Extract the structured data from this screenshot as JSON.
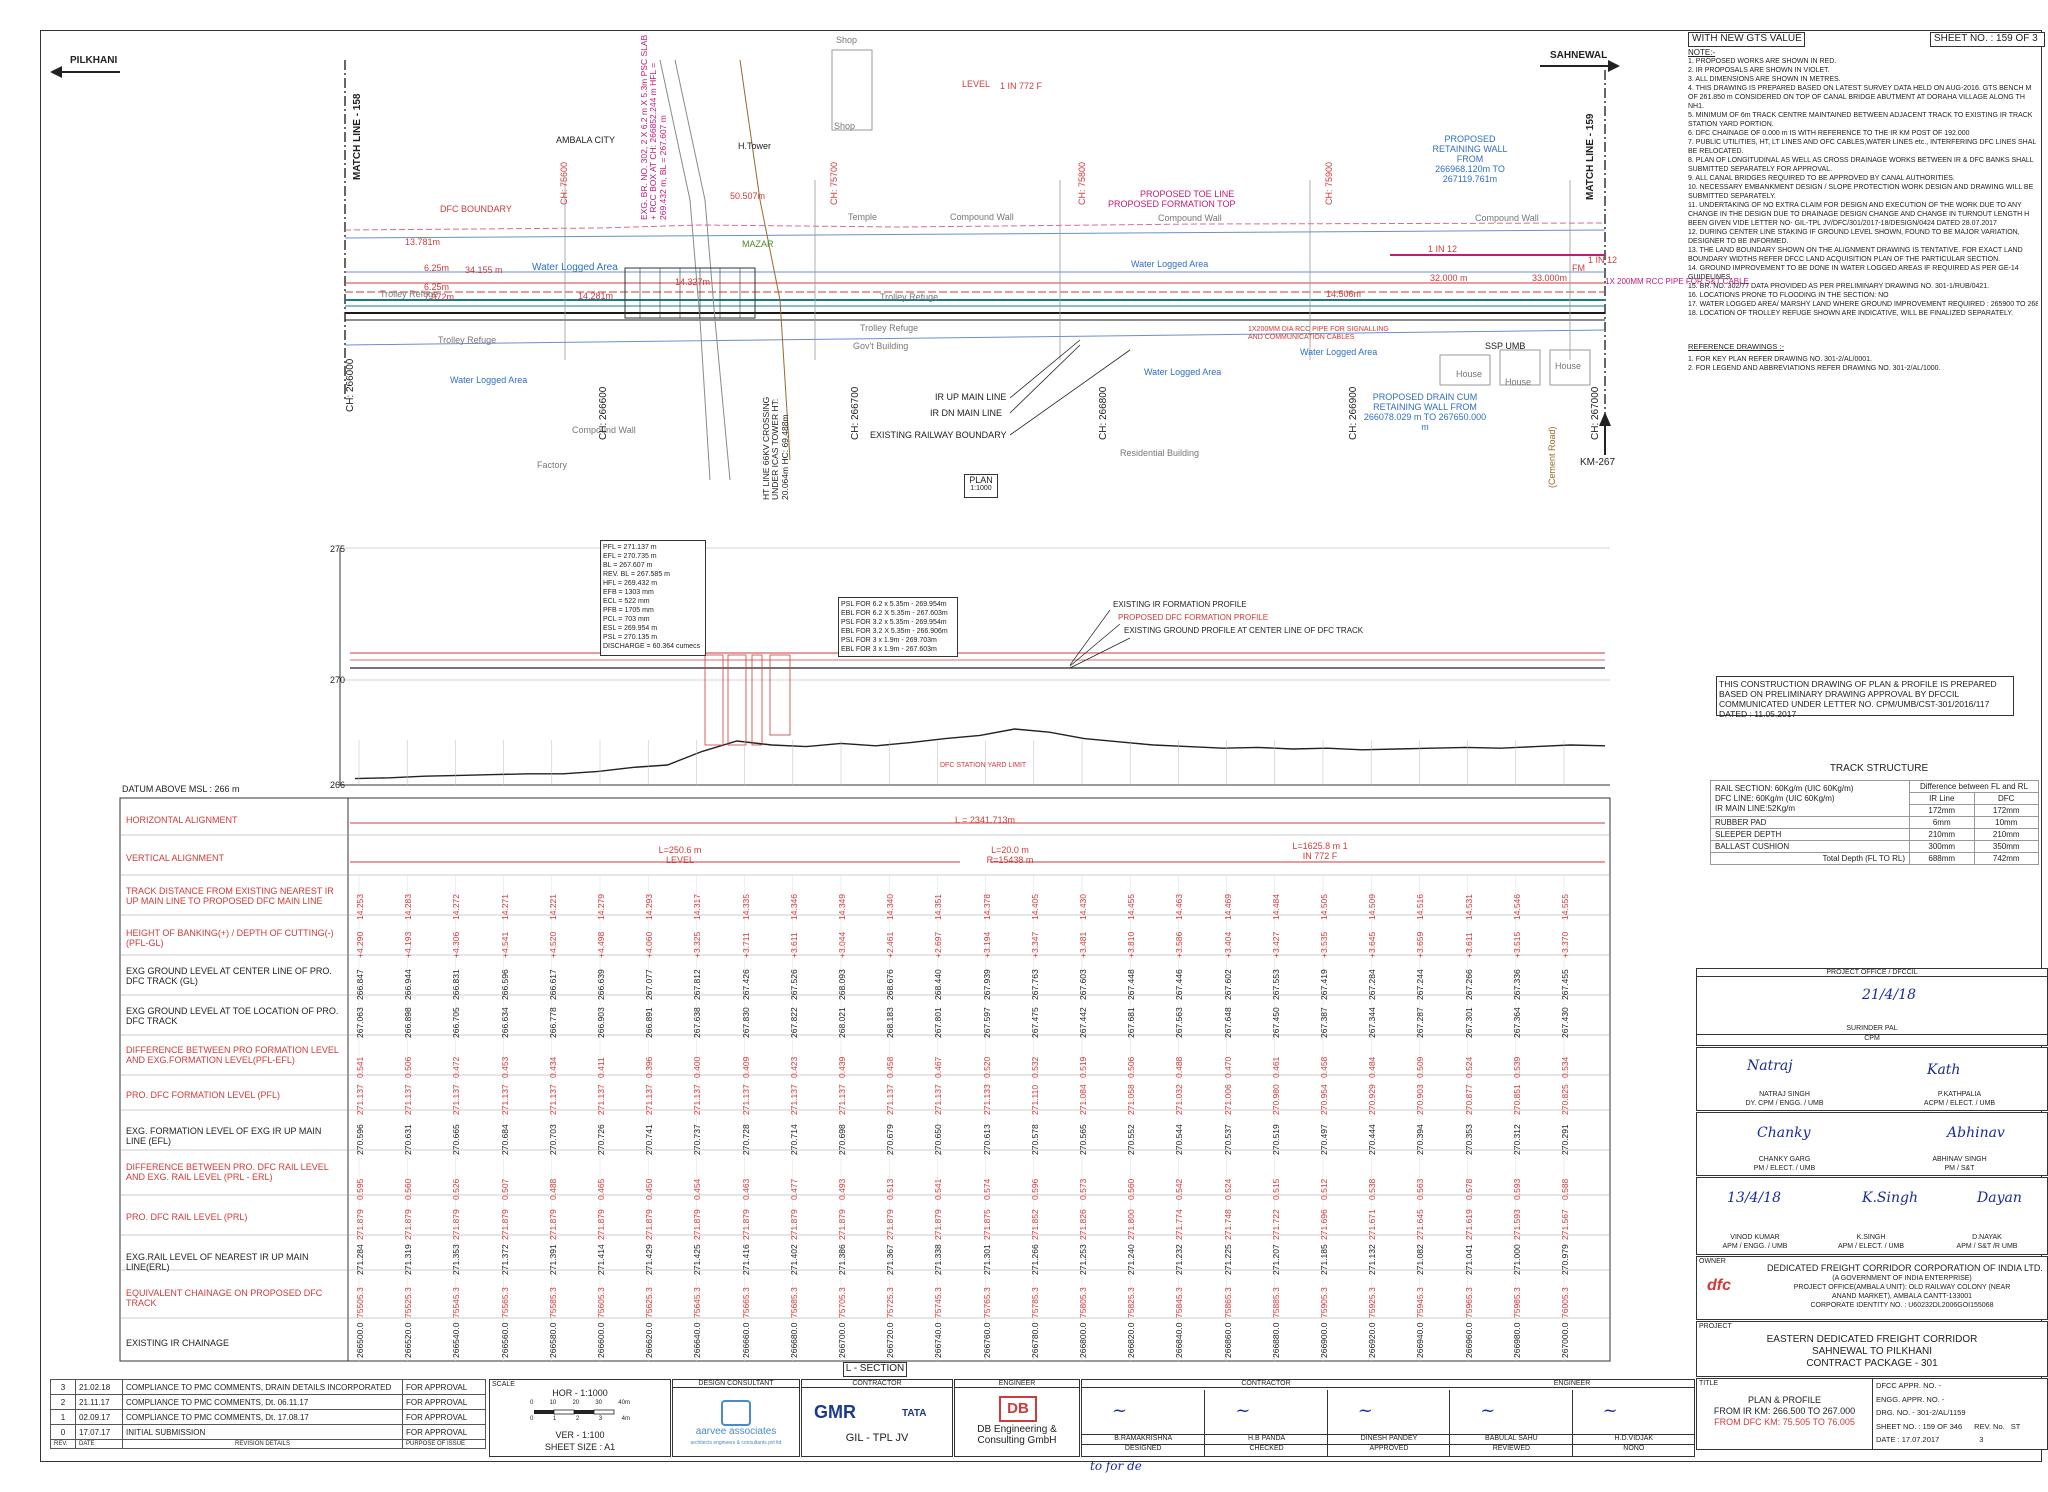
{
  "sheet": {
    "header": "WITH NEW GTS VALUE",
    "sheet_no": "SHEET NO. : 159 OF 3"
  },
  "plan": {
    "left_dir": "PILKHANI",
    "right_dir": "SAHNEWAL",
    "match_left": "MATCH LINE - 158",
    "match_right": "MATCH LINE - 159",
    "plan_label": "PLAN",
    "plan_scale": "1:1000",
    "km_marker": "KM-267",
    "labels": {
      "ambala_city": "AMBALA CITY",
      "dfc_boundary": "DFC BOUNDARY",
      "water_logged": "Water Logged Area",
      "trolley_refuge": "Trolley Refuge",
      "compound_wall": "Compound Wall",
      "factory": "Factory",
      "residential": "Residential Building",
      "shop": "Shop",
      "temple": "Temple",
      "govt_building": "Gov't Building",
      "house": "House",
      "h_tower": "H.Tower",
      "mazar": "MAZAR",
      "level": "LEVEL",
      "in772": "1 IN 772 F",
      "in12": "1 IN 12",
      "fm": "FM",
      "ir_up": "IR UP MAIN LINE",
      "ir_dn": "IR DN MAIN LINE",
      "exist_boundary": "EXISTING RAILWAY BOUNDARY",
      "prop_toe": "PROPOSED TOE LINE",
      "prop_formation_top": "PROPOSED FORMATION TOP",
      "ret_wall": "PROPOSED RETAINING WALL FROM 266968.120m TO 267119.761m",
      "drain_cum": "PROPOSED DRAIN CUM RETAINING WALL FROM 266078.029 m TO 267650.000 m",
      "pipe": "1X200MM DIA RCC PIPE FOR SIGNALLING AND COMMUNICATION CABLES",
      "ssp": "SSP UMB",
      "cement_road": "(Cement Road)",
      "dim1": "13.781m",
      "dim2": "6.25m",
      "dim3": "34.155 m",
      "dim4": "6.25m",
      "dim5": "7.972m",
      "dim6": "14.281m",
      "dim7": "14.327m",
      "dim8": "50.507m",
      "dim9": "14.506m",
      "dim10": "32.000 m",
      "dim11": "33.000m",
      "hand_note": "1X 200MM RCC PIPE FOR S&T CABLE"
    },
    "chainages": [
      "CH: 266000",
      "CH: 266600",
      "CH: 266700",
      "CH: 266800",
      "CH: 266900",
      "CH: 267000",
      "CH: 75600",
      "CH: 75700",
      "CH: 75800",
      "CH: 75900"
    ],
    "bridge_text": "EXG. BR. NO. 302, 2 X 6.2 m X 5.3m PSC SLAB + RCC BOX AT CH: 266852.244 m HFL = 269.432 m, BL = 267.607 m",
    "ht_line": "HT LINE 66KV CROSSING UNDER ICAS TOWER HT: 20.064m HC: 69.488m"
  },
  "profile": {
    "datum": "DATUM ABOVE MSL : 266 m",
    "y_ticks": [
      "275",
      "270",
      "266"
    ],
    "legend": [
      "EXISTING IR FORMATION PROFILE",
      "PROPOSED DFC FORMATION PROFILE",
      "EXISTING GROUND PROFILE AT CENTER LINE OF DFC TRACK"
    ],
    "station_label": "DFC STATION YARD LIMIT",
    "bridge_box": [
      "PFL = 271.137 m",
      "EFL = 270.735 m",
      "BL = 267.607 m",
      "REV. BL = 267.585 m",
      "HFL = 269.432 m",
      "EFB = 1303 mm",
      "ECL = 522 mm",
      "PFB = 1705 mm",
      "PCL = 703 mm",
      "ESL = 269.954 m",
      "PSL = 270.135 m",
      "DISCHARGE = 60.364 cumecs"
    ],
    "psl_box": [
      "PSL FOR 6.2 x 5.35m - 269.954m",
      "EBL FOR 6.2 X 5.35m - 267.603m",
      "PSL FOR 3.2 x 5.35m - 269.954m",
      "EBL FOR 3.2 X 5.35m - 266.906m",
      "PSL FOR 3 x 1.9m - 269.703m",
      "EBL FOR 3 x 1.9m - 267.603m"
    ],
    "ground_profile": [
      0.08,
      0.09,
      0.11,
      0.12,
      0.13,
      0.14,
      0.14,
      0.17,
      0.22,
      0.25,
      0.42,
      0.55,
      0.5,
      0.48,
      0.52,
      0.49,
      0.53,
      0.58,
      0.62,
      0.7,
      0.66,
      0.58,
      0.54,
      0.5,
      0.48,
      0.46,
      0.47,
      0.45,
      0.46,
      0.44,
      0.45,
      0.46,
      0.47,
      0.46,
      0.48,
      0.5,
      0.49
    ]
  },
  "lsection": {
    "title": "L - SECTION",
    "rows": {
      "h_align": "HORIZONTAL ALIGNMENT",
      "v_align": "VERTICAL ALIGNMENT",
      "track_dist": "TRACK DISTANCE FROM EXISTING NEAREST IR UP MAIN LINE TO PROPOSED DFC MAIN LINE",
      "bank": "HEIGHT OF BANKING(+) / DEPTH OF CUTTING(-) (PFL-GL)",
      "gl_center": "EXG GROUND LEVEL AT CENTER LINE OF PRO. DFC TRACK (GL)",
      "gl_toe": "EXG GROUND LEVEL AT TOE LOCATION OF PRO. DFC TRACK",
      "diff_pfl": "DIFFERENCE BETWEEN PRO FORMATION LEVEL AND EXG.FORMATION LEVEL(PFL-EFL)",
      "pfl": "PRO. DFC FORMATION LEVEL (PFL)",
      "efl": "EXG. FORMATION LEVEL OF EXG IR UP MAIN LINE (EFL)",
      "diff_prl": "DIFFERENCE BETWEEN PRO. DFC RAIL LEVEL AND EXG. RAIL LEVEL (PRL - ERL)",
      "prl": "PRO. DFC RAIL LEVEL (PRL)",
      "erl": "EXG.RAIL LEVEL OF NEAREST IR UP MAIN LINE(ERL)",
      "eq_chain": "EQUIVALENT CHAINAGE ON PROPOSED DFC TRACK",
      "ir_chain": "EXISTING IR CHAINAGE"
    },
    "h_align_val": "L = 2341.713m",
    "v_align_vals": [
      "L=250.6 m LEVEL",
      "L=20.0 m R=15438 m",
      "L=1625.8 m 1 IN 772 F"
    ],
    "track_dist": [
      "14.253",
      "14.283",
      "14.272",
      "14.271",
      "14.221",
      "14.279",
      "14.293",
      "14.317",
      "14.335",
      "14.346",
      "14.349",
      "14.340",
      "14.351",
      "14.378",
      "14.405",
      "14.430",
      "14.455",
      "14.463",
      "14.469",
      "14.484",
      "14.505",
      "14.509",
      "14.516",
      "14.531",
      "14.546",
      "14.555"
    ],
    "bank": [
      "+4.290",
      "+4.193",
      "+4.306",
      "+4.541",
      "+4.520",
      "+4.498",
      "+4.060",
      "+3.325",
      "+3.711",
      "+3.611",
      "+3.044",
      "+2.461",
      "+2.697",
      "+3.194",
      "+3.347",
      "+3.481",
      "+3.810",
      "+3.586",
      "+3.404",
      "+3.427",
      "+3.535",
      "+3.645",
      "+3.659",
      "+3.611",
      "+3.515",
      "+3.370"
    ],
    "gl_center": [
      "266.847",
      "266.944",
      "266.831",
      "266.596",
      "266.617",
      "266.639",
      "267.077",
      "267.812",
      "267.426",
      "267.526",
      "268.093",
      "268.676",
      "268.440",
      "267.939",
      "267.763",
      "267.603",
      "267.448",
      "267.446",
      "267.602",
      "267.553",
      "267.419",
      "267.284",
      "267.244",
      "267.266",
      "267.336",
      "267.455"
    ],
    "gl_toe": [
      "267.063",
      "266.898",
      "266.705",
      "266.634",
      "266.778",
      "266.903",
      "266.891",
      "267.638",
      "267.830",
      "267.822",
      "268.021",
      "268.183",
      "267.801",
      "267.597",
      "267.475",
      "267.442",
      "267.681",
      "267.563",
      "267.648",
      "267.450",
      "267.387",
      "267.344",
      "267.287",
      "267.301",
      "267.364",
      "267.430"
    ],
    "diff_pfl": [
      "0.541",
      "0.506",
      "0.472",
      "0.453",
      "0.434",
      "0.411",
      "0.396",
      "0.400",
      "0.409",
      "0.423",
      "0.439",
      "0.458",
      "0.467",
      "0.520",
      "0.532",
      "0.519",
      "0.506",
      "0.488",
      "0.470",
      "0.461",
      "0.458",
      "0.484",
      "0.509",
      "0.524",
      "0.539",
      "0.534"
    ],
    "pfl": [
      "271.137",
      "271.137",
      "271.137",
      "271.137",
      "271.137",
      "271.137",
      "271.137",
      "271.137",
      "271.137",
      "271.137",
      "271.137",
      "271.137",
      "271.137",
      "271.133",
      "271.110",
      "271.084",
      "271.058",
      "271.032",
      "271.006",
      "270.980",
      "270.954",
      "270.929",
      "270.903",
      "270.877",
      "270.851",
      "270.825"
    ],
    "efl": [
      "270.596",
      "270.631",
      "270.665",
      "270.684",
      "270.703",
      "270.726",
      "270.741",
      "270.737",
      "270.728",
      "270.714",
      "270.698",
      "270.679",
      "270.650",
      "270.613",
      "270.578",
      "270.565",
      "270.552",
      "270.544",
      "270.537",
      "270.519",
      "270.497",
      "270.444",
      "270.394",
      "270.353",
      "270.312",
      "270.291"
    ],
    "diff_prl": [
      "0.595",
      "0.560",
      "0.526",
      "0.507",
      "0.488",
      "0.465",
      "0.450",
      "0.454",
      "0.463",
      "0.477",
      "0.493",
      "0.513",
      "0.541",
      "0.574",
      "0.596",
      "0.573",
      "0.560",
      "0.542",
      "0.524",
      "0.515",
      "0.512",
      "0.538",
      "0.563",
      "0.578",
      "0.593",
      "0.588"
    ],
    "prl": [
      "271.879",
      "271.879",
      "271.879",
      "271.879",
      "271.879",
      "271.879",
      "271.879",
      "271.879",
      "271.879",
      "271.879",
      "271.879",
      "271.879",
      "271.879",
      "271.875",
      "271.852",
      "271.826",
      "271.800",
      "271.774",
      "271.748",
      "271.722",
      "271.696",
      "271.671",
      "271.645",
      "271.619",
      "271.593",
      "271.567"
    ],
    "erl": [
      "271.284",
      "271.319",
      "271.353",
      "271.372",
      "271.391",
      "271.414",
      "271.429",
      "271.425",
      "271.416",
      "271.402",
      "271.386",
      "271.367",
      "271.338",
      "271.301",
      "271.266",
      "271.253",
      "271.240",
      "271.232",
      "271.225",
      "271.207",
      "271.185",
      "271.132",
      "271.082",
      "271.041",
      "271.000",
      "270.979"
    ],
    "eq_chain": [
      "75505.3",
      "75525.3",
      "75545.3",
      "75565.3",
      "75585.3",
      "75605.3",
      "75625.3",
      "75645.3",
      "75665.3",
      "75685.3",
      "75705.3",
      "75725.3",
      "75745.3",
      "75765.3",
      "75785.3",
      "75805.3",
      "75825.3",
      "75845.3",
      "75865.3",
      "75885.3",
      "75905.3",
      "75925.3",
      "75945.3",
      "75965.3",
      "75985.3",
      "76005.3"
    ],
    "ir_chain": [
      "266500.0",
      "266520.0",
      "266540.0",
      "266560.0",
      "266580.0",
      "266600.0",
      "266620.0",
      "266640.0",
      "266660.0",
      "266680.0",
      "266700.0",
      "266720.0",
      "266740.0",
      "266760.0",
      "266780.0",
      "266800.0",
      "266820.0",
      "266840.0",
      "266860.0",
      "266880.0",
      "266900.0",
      "266920.0",
      "266940.0",
      "266960.0",
      "266980.0",
      "267000.0"
    ]
  },
  "notes": {
    "title": "NOTE:-",
    "items": [
      "1.  PROPOSED WORKS ARE SHOWN IN RED.",
      "2.  IR PROPOSALS ARE SHOWN IN VIOLET.",
      "3.  ALL DIMENSIONS ARE SHOWN IN METRES.",
      "4.  THIS DRAWING IS PREPARED BASED ON LATEST SURVEY DATA HELD ON AUG-2016. GTS BENCH M",
      "     OF 261.850 m CONSIDERED ON TOP OF CANAL BRIDGE ABUTMENT AT DORAHA VILLAGE ALONG TH",
      "     NH1.",
      "5.  MINIMUM OF 6m TRACK CENTRE MAINTAINED BETWEEN ADJACENT TRACK TO EXISTING IR TRACK",
      "     STATION YARD PORTION.",
      "6.  DFC CHAINAGE OF 0.000 m IS WITH REFERENCE TO THE IR KM POST OF 192.000",
      "7.  PUBLIC UTILITIES, HT, LT LINES AND OFC CABLES,WATER LINES etc., INTERFERING DFC LINES SHAL",
      "     BE RELOCATED.",
      "8.  PLAN OF LONGITUDINAL AS WELL AS CROSS DRAINAGE WORKS BETWEEN IR & DFC BANKS SHALL",
      "     SUBMITTED SEPARATELY FOR APPROVAL.",
      "9.  ALL CANAL BRIDGES REQUIRED TO BE APPROVED BY CANAL AUTHORITIES.",
      "10. NECESSARY EMBANKMENT DESIGN / SLOPE PROTECTION WORK DESIGN AND DRAWING WILL BE",
      "     SUBMITTED SEPARATELY.",
      "11. UNDERTAKING OF NO EXTRA CLAIM FOR DESIGN AND EXECUTION OF THE WORK DUE TO ANY",
      "     CHANGE IN THE DESIGN DUE TO DRAINAGE DESIGN CHANGE AND CHANGE IN TURNOUT LENGTH H",
      "     BEEN GIVEN VIDE LETTER NO- GIL-TPL JV/DFC/301/2017-18/DESIGN/0424 DATED 28.07.2017",
      "12. DURING CENTER LINE STAKING IF GROUND LEVEL SHOWN, FOUND TO BE MAJOR VARIATION,",
      "     DESIGNER TO BE INFORMED.",
      "13. THE LAND BOUNDARY SHOWN ON THE ALIGNMENT DRAWING IS TENTATIVE. FOR EXACT LAND",
      "     BOUNDARY WIDTHS REFER DFCC LAND ACQUISITION PLAN OF THE PARTICULAR SECTION.",
      "14. GROUND IMPROVEMENT TO BE DONE IN WATER LOGGED AREAS IF REQUIRED AS PER  GE-14",
      "     GUIDELINES.",
      "15. BR. NO. 302/77 DATA PROVIDED AS PER PRELIMINARY DRAWING NO. 301-1/RUB/0421.",
      "16. LOCATIONS PRONE TO FLOODING IN THE SECTION: NO",
      "17. WATER LOGGED AREA/ MARSHY LAND WHERE GROUND IMPROVEMENT REQUIRED : 265900 TO 2685",
      "18. LOCATION OF TROLLEY REFUGE SHOWN ARE INDICATIVE, WILL BE FINALIZED SEPARATELY."
    ],
    "ref_title": "REFERENCE DRAWINGS :-",
    "refs": [
      "1.   FOR KEY PLAN REFER DRAWING NO. 301-2/AL/0001.",
      "2.   FOR LEGEND AND ABBREVIATIONS REFER  DRAWING NO. 301-2/AL/1000."
    ]
  },
  "approval_note": "THIS CONSTRUCTION DRAWING OF PLAN & PROFILE IS PREPARED BASED ON PRELIMINARY DRAWING APPROVAL BY DFCCIL COMMUNICATED UNDER LETTER NO. CPM/UMB/CST-301/2016/117          DATED : 11.05.2017",
  "track_structure": {
    "title": "TRACK STRUCTURE",
    "desc": [
      "RAIL SECTION: 60Kg/m (UIC 60Kg/m)",
      "DFC LINE: 60Kg/m (UIC 60Kg/m)",
      "IR MAIN LINE:52Kg/m"
    ],
    "diff_head": "Difference between FL and RL",
    "col_ir": "IR Line",
    "col_dfc": "DFC",
    "rows": [
      {
        "name": "",
        "ir": "172mm",
        "dfc": "172mm"
      },
      {
        "name": "RUBBER PAD",
        "ir": "6mm",
        "dfc": "10mm"
      },
      {
        "name": "SLEEPER DEPTH",
        "ir": "210mm",
        "dfc": "210mm"
      },
      {
        "name": "BALLAST CUSHION",
        "ir": "300mm",
        "dfc": "350mm"
      },
      {
        "name": "Total Depth (FL TO RL)",
        "ir": "688mm",
        "dfc": "742mm"
      }
    ]
  },
  "signatures": {
    "office": "PROJECT OFFICE / DFCCIL",
    "p1": {
      "name": "SURINDER PAL",
      "role": "CPM",
      "sign": "21/4/18"
    },
    "p2": {
      "name": "NATRAJ SINGH",
      "role": "DY. CPM / ENGG. / UMB",
      "sign": "Natraj"
    },
    "p3": {
      "name": "P.KATHPALIA",
      "role": "ACPM / ELECT. / UMB",
      "sign": "Kath"
    },
    "p4": {
      "name": "CHANKY GARG",
      "role": "PM / ELECT. / UMB",
      "sign": "Chanky"
    },
    "p5": {
      "name": "ABHINAV SINGH",
      "role": "PM / S&T",
      "sign": "Abhinav"
    },
    "p6": {
      "name": "VINOD KUMAR",
      "role": "APM / ENGG. / UMB",
      "sign": "13/4/18"
    },
    "p7": {
      "name": "K.SINGH",
      "role": "APM / ELECT. / UMB",
      "sign": "K.Singh"
    },
    "p8": {
      "name": "D.NAYAK",
      "role": "APM / S&T /R UMB",
      "sign": "Dayan"
    }
  },
  "owner": {
    "label": "OWNER",
    "name": "DEDICATED FREIGHT CORRIDOR CORPORATION OF INDIA LTD.",
    "l2": "(A GOVERNMENT OF INDIA ENTERPRISE)",
    "l3": "PROJECT OFFICE(AMBALA UNIT): OLD RAILWAY COLONY (NEAR",
    "l4": "ANAND MARKET), AMBALA CANTT-133001",
    "l5": "CORPORATE IDENTITY NO. : U60232DL2006GOI155068",
    "logo": "dfc"
  },
  "project": {
    "label": "PROJECT",
    "l1": "EASTERN DEDICATED FREIGHT CORRIDOR",
    "l2": "SAHNEWAL TO PILKHANI",
    "l3": "CONTRACT PACKAGE - 301"
  },
  "titleblock": {
    "title_label": "TITLE",
    "t1": "PLAN & PROFILE",
    "t2": "FROM IR KM: 266.500 TO 267.000",
    "t3": "FROM DFC KM: 75.505 TO 76.005",
    "dfcc_appr": "DFCC APPR. NO. -",
    "engg_appr": "ENGG. APPR. NO. -",
    "drg_no": "DRG. NO. - 301-2/AL/1159",
    "sheet_no": "SHEET NO. : 159 OF 346",
    "rev_no": "REV. No.",
    "rev_val": "3",
    "date": "DATE   :  17.07.2017",
    "st": "ST"
  },
  "revisions": [
    {
      "rev": "3",
      "date": "21.02.18",
      "desc": "COMPLIANCE TO PMC COMMENTS, DRAIN DETAILS INCORPORATED",
      "purpose": "FOR APPROVAL"
    },
    {
      "rev": "2",
      "date": "21.11.17",
      "desc": "COMPLIANCE TO PMC COMMENTS, Dt. 06.11.17",
      "purpose": "FOR APPROVAL"
    },
    {
      "rev": "1",
      "date": "02.09.17",
      "desc": "COMPLIANCE TO PMC COMMENTS, Dt. 17.08.17",
      "purpose": "FOR APPROVAL"
    },
    {
      "rev": "0",
      "date": "17.07.17",
      "desc": "INITIAL SUBMISSION",
      "purpose": "FOR APPROVAL"
    }
  ],
  "rev_headers": {
    "rev": "REV.",
    "date": "DATE",
    "desc": "REVISION DETAILS",
    "purpose": "PURPOSE OF ISSUE"
  },
  "scale": {
    "label": "SCALE",
    "hor": "HOR - 1:1000",
    "ver": "VER - 1:100",
    "size": "SHEET SIZE : A1",
    "ticks": [
      "0",
      "10",
      "20",
      "30",
      "40m"
    ],
    "ticks2": [
      "0",
      "1",
      "2",
      "3",
      "4m"
    ]
  },
  "consultant": {
    "label": "DESIGN CONSULTANT",
    "name": "aarvee associates",
    "sub": "architects engineers & consultants pvt ltd"
  },
  "contractor": {
    "label": "CONTRACTOR",
    "gmr": "GMR",
    "tata": "TATA",
    "jv": "GIL - TPL JV"
  },
  "engineer": {
    "label": "ENGINEER",
    "db": "DB",
    "name": "DB Engineering & Consulting GmbH"
  },
  "contractor_sigs": {
    "label": "CONTRACTOR",
    "eng_label": "ENGINEER",
    "names": [
      "B.RAMAKRISHNA",
      "H.B PANDA",
      "DINESH PANDEY",
      "BABULAL SAHU",
      "H.D.VIDJAK"
    ],
    "roles": [
      "DESIGNED",
      "CHECKED",
      "APPROVED",
      "REVIEWED",
      "NONO"
    ]
  },
  "footer_scribble": "to  for  de"
}
